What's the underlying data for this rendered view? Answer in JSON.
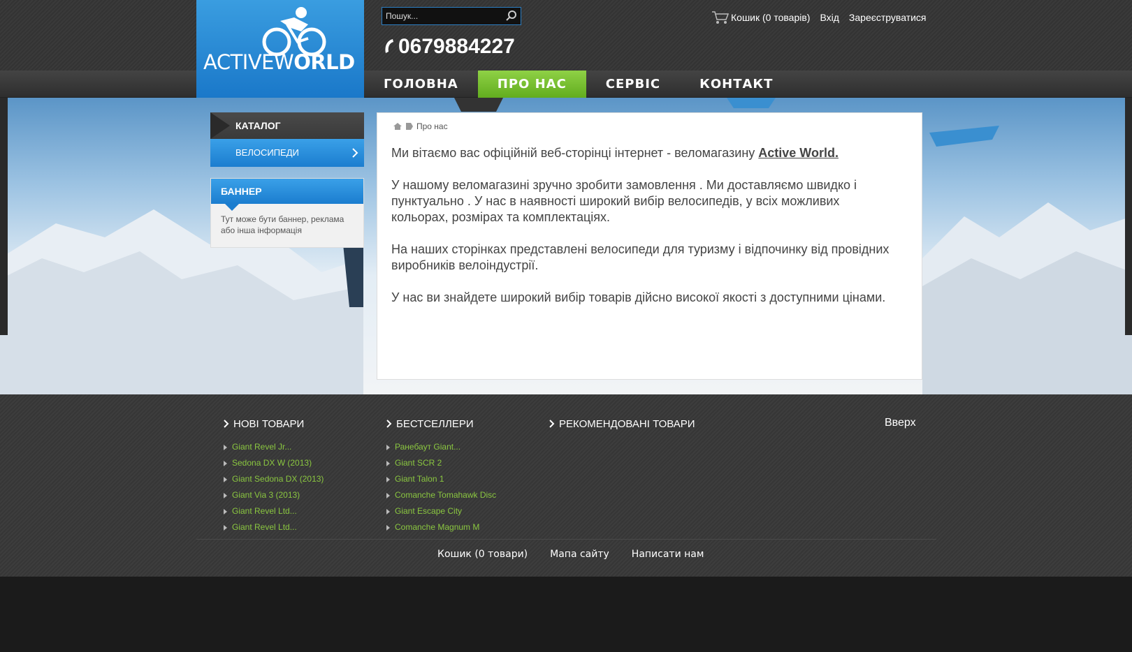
{
  "logo": {
    "part1": "ACTIVEW",
    "part2": "RLD"
  },
  "search": {
    "placeholder": "Пошук..."
  },
  "phone": "0679884227",
  "top_links": {
    "cart": "Кошик (0 товарів)",
    "login": "Вхід",
    "register": "Зареєструватися"
  },
  "nav": [
    {
      "label": "ГОЛОВНА",
      "active": false
    },
    {
      "label": "ПРО НАС",
      "active": true
    },
    {
      "label": "СЕРВІС",
      "active": false
    },
    {
      "label": "КОНТАКТ",
      "active": false
    }
  ],
  "sidebar": {
    "catalog_title": "КАТАЛОГ",
    "catalog_items": [
      "ВЕЛОСИПЕДИ"
    ],
    "banner_title": "БАННЕР",
    "banner_text": "Тут може бути баннер, реклама або інша інформація"
  },
  "breadcrumb": {
    "current": "Про нас"
  },
  "content": {
    "intro": "Ми вітаємо вас офіційній веб-сторінці інтернет - веломагазину ",
    "intro_link": "Active World.",
    "p2": "У нашому веломагазині зручно зробити замовлення . Ми доставляємо швидко і пунктуально . У нас в наявності широкий вибір велосипедів, у всіх можливих кольорах, розмірах та комплектаціях.",
    "p3": "На наших сторінках представлені велосипеди для туризму і відпочинку від провідних виробників велоіндустрії.",
    "p4": "У нас ви знайдете широкий вибір товарів дійсно високої якості з доступними цінами."
  },
  "footer": {
    "new_title": "НОВІ ТОВАРИ",
    "new_items": [
      "Giant Revel Jr...",
      "Sedona DX W (2013)",
      "Giant Sedona DX (2013)",
      "Giant Via 3 (2013)",
      "Giant Revel Ltd...",
      "Giant Revel Ltd..."
    ],
    "best_title": "БЕСТСЕЛЛЕРИ",
    "best_items": [
      "Ранебаут Giant...",
      "Giant SCR 2",
      "Giant Talon 1",
      "Comanche Tomahawk Disc",
      "Giant Escape City",
      "Comanche Magnum M"
    ],
    "rec_title": "РЕКОМЕНДОВАНІ ТОВАРИ",
    "to_top": "Вверх",
    "bottom_links": [
      "Кошик (0 товари)",
      "Мапа сайту",
      "Написати нам"
    ]
  },
  "colors": {
    "accent_blue": "#1b7dcf",
    "nav_active_green": "#62ad1f",
    "footer_link_green": "#8ac640"
  }
}
